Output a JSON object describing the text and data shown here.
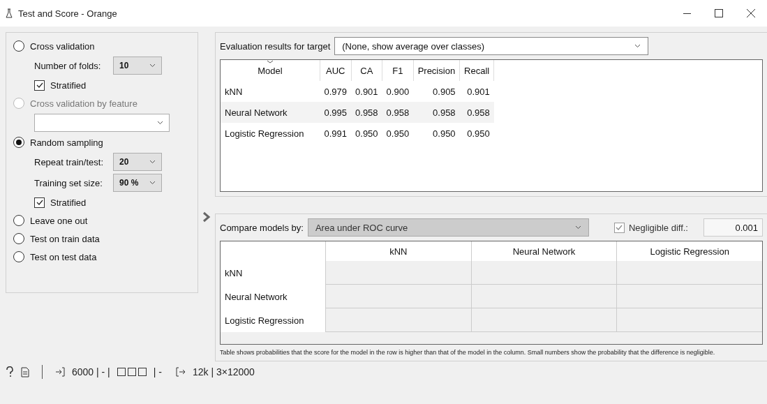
{
  "window": {
    "title": "Test and Score - Orange"
  },
  "sampling": [
    {
      "kind": "radio",
      "label": "Cross validation",
      "selected": false,
      "disabled": false
    },
    {
      "kind": "combo",
      "label": "Number of folds:",
      "value": "10"
    },
    {
      "kind": "check",
      "label": "Stratified",
      "checked": true
    },
    {
      "kind": "radio",
      "label": "Cross validation by feature",
      "selected": false,
      "disabled": true
    },
    {
      "kind": "combo"
    },
    {
      "kind": "radio",
      "label": "Random sampling",
      "selected": true,
      "disabled": false
    },
    {
      "kind": "combo",
      "label": "Repeat train/test:",
      "value": "20"
    },
    {
      "kind": "combo",
      "label": "Training set size:",
      "value": "90 %"
    },
    {
      "kind": "check",
      "label": "Stratified",
      "checked": true
    },
    {
      "kind": "radio",
      "label": "Leave one out",
      "selected": false,
      "disabled": false
    },
    {
      "kind": "radio",
      "label": "Test on train data",
      "selected": false,
      "disabled": false
    },
    {
      "kind": "radio",
      "label": "Test on test data",
      "selected": false,
      "disabled": false
    }
  ],
  "evaluation": {
    "target_label": "Evaluation results for target",
    "target_value": "(None, show average over classes)",
    "columns": [
      "Model",
      "AUC",
      "CA",
      "F1",
      "Precision",
      "Recall"
    ],
    "rows": [
      [
        "kNN",
        "0.979",
        "0.901",
        "0.900",
        "0.905",
        "0.901"
      ],
      [
        "Neural Network",
        "0.995",
        "0.958",
        "0.958",
        "0.958",
        "0.958"
      ],
      [
        "Logistic Regression",
        "0.991",
        "0.950",
        "0.950",
        "0.950",
        "0.950"
      ]
    ]
  },
  "comparison": {
    "label": "Compare models by:",
    "value": "Area under ROC curve",
    "negligible_label": "Negligible diff.:",
    "negligible_checked": true,
    "negligible_value": "0.001",
    "columns": [
      "kNN",
      "Neural Network",
      "Logistic Regression"
    ],
    "rows": [
      "kNN",
      "Neural Network",
      "Logistic Regression"
    ],
    "note": "Table shows probabilities that the score for the model in the row is higher than that of the model in the column. Small numbers show the probability that the difference is negligible."
  },
  "status_bar": {
    "input_count": "6000 | - |",
    "input_tail": "| -",
    "output": "12k | 3×12000"
  }
}
